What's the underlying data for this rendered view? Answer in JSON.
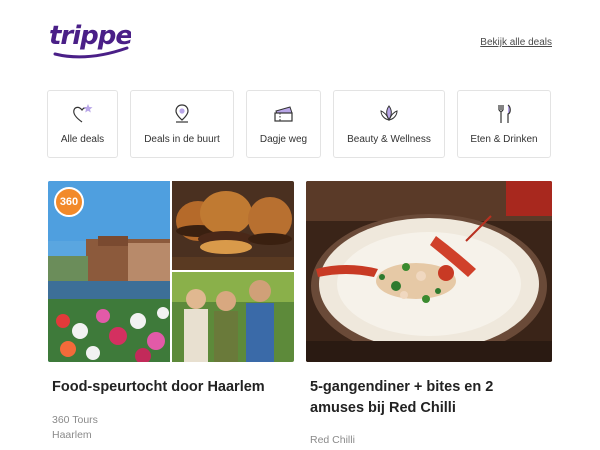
{
  "brand": {
    "logo_text": "tripper",
    "color": "#4a1f87"
  },
  "header": {
    "all_deals_link": "Bekijk alle deals"
  },
  "categories": [
    {
      "label": "Alle deals",
      "icon": "heart-star-icon"
    },
    {
      "label": "Deals in de buurt",
      "icon": "location-pin-icon"
    },
    {
      "label": "Dagje weg",
      "icon": "ticket-icon"
    },
    {
      "label": "Beauty & Wellness",
      "icon": "lotus-icon"
    },
    {
      "label": "Eten & Drinken",
      "icon": "fork-knife-icon"
    }
  ],
  "deals": [
    {
      "title": "Food-speurtocht door Haarlem",
      "provider": "360 Tours",
      "location": "Haarlem",
      "badge": "360"
    },
    {
      "title": "5-gangendiner + bites en 2 amuses bij Red Chilli",
      "provider": "Red Chilli"
    }
  ],
  "colors": {
    "accent": "#4a1f87",
    "icon_fill": "#b9a6e8",
    "border": "#e3e3e3"
  }
}
